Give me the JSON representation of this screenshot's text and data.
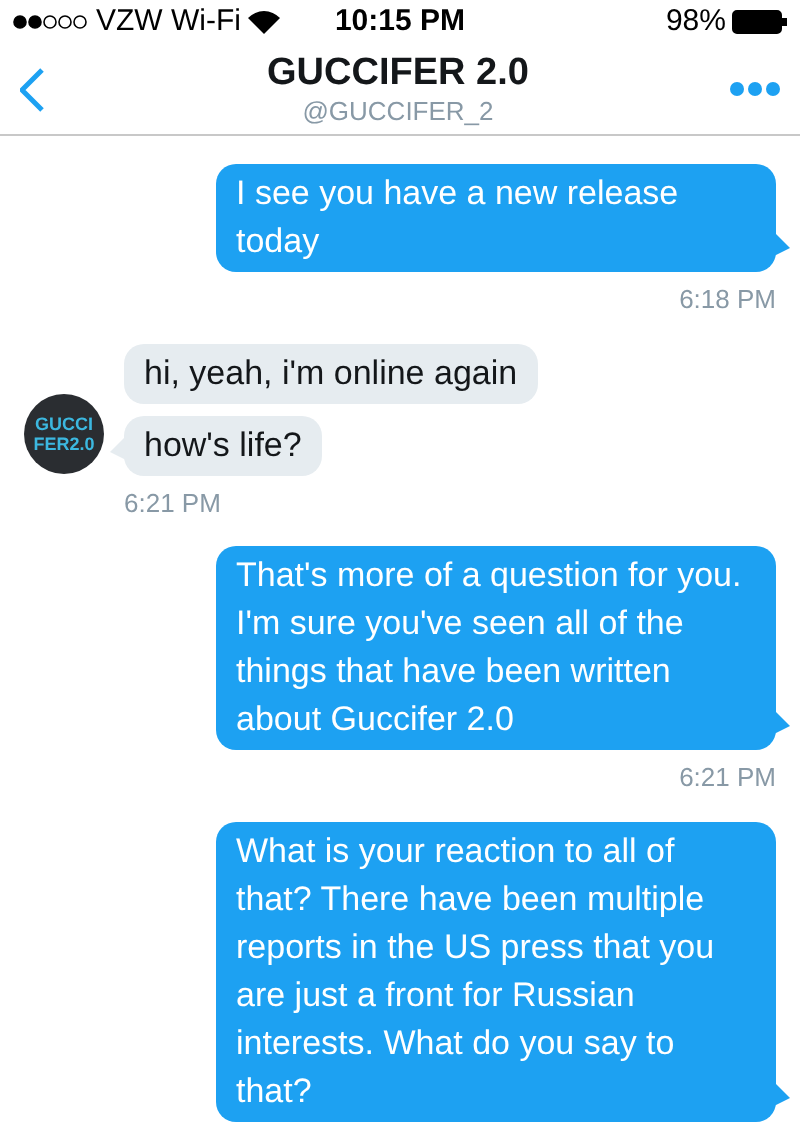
{
  "status_bar": {
    "carrier": "VZW Wi-Fi",
    "time": "10:15 PM",
    "battery": "98%"
  },
  "header": {
    "title": "GUCCIFER 2.0",
    "handle": "@GUCCIFER_2"
  },
  "avatar_text": [
    "GUCCI",
    "FER2.0"
  ],
  "messages": [
    {
      "kind": "outgoing",
      "bubbles": [
        "I see you have a new release today"
      ],
      "time": "6:18 PM"
    },
    {
      "kind": "incoming",
      "bubbles": [
        "hi, yeah, i'm online again",
        "how's life?"
      ],
      "time": "6:21 PM"
    },
    {
      "kind": "outgoing",
      "bubbles": [
        "That's more of a question for you. I'm sure you've seen all of the things that have been written about Guccifer 2.0"
      ],
      "time": "6:21 PM"
    },
    {
      "kind": "outgoing",
      "bubbles": [
        "What is your reaction to all of that? There have been multiple reports in the US press that you are just a front for Russian interests. What do you say to that?"
      ]
    }
  ]
}
